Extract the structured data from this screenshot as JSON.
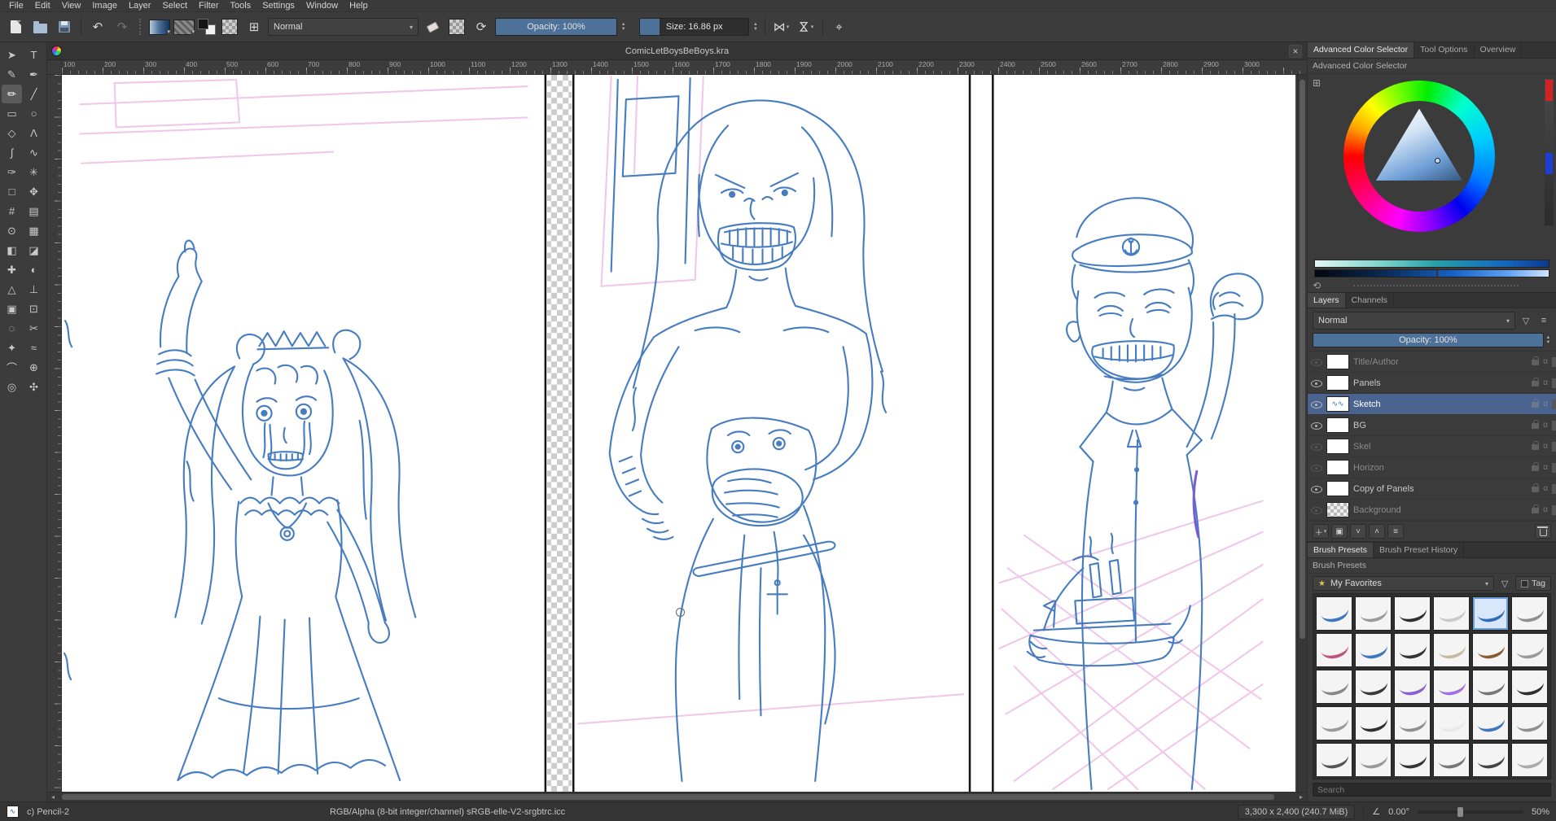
{
  "menubar": {
    "items": [
      "File",
      "Edit",
      "View",
      "Image",
      "Layer",
      "Select",
      "Filter",
      "Tools",
      "Settings",
      "Window",
      "Help"
    ]
  },
  "toolbar": {
    "blend_mode": "Normal",
    "opacity": "Opacity: 100%",
    "size": "Size: 16.86 px"
  },
  "document": {
    "tab_title": "ComicLetBoysBeBoys.kra"
  },
  "icons": {
    "undo": "↶",
    "redo": "↷",
    "reload": "⟳",
    "mirror": "⋈",
    "wrap": "⌖",
    "grid": "⊞",
    "close": "×",
    "caret": "▾",
    "spin_up": "▴",
    "spin_down": "▾",
    "star": "★",
    "filter": "▽",
    "options": "≡",
    "plus": "＋",
    "duplicate": "▣",
    "up": "˄",
    "down": "˅",
    "properties": "≡",
    "arrow_left": "◂",
    "arrow_right": "▸",
    "angle": "∠",
    "refresh": "⟲"
  },
  "toolbox": {
    "tools": [
      {
        "name": "select-shapes-tool",
        "glyph": "➤"
      },
      {
        "name": "text-tool",
        "glyph": "T"
      },
      {
        "name": "edit-shapes-tool",
        "glyph": "✎"
      },
      {
        "name": "calligraphy-tool",
        "glyph": "✒"
      },
      {
        "name": "freehand-brush-tool",
        "glyph": "✏",
        "active": true
      },
      {
        "name": "line-tool",
        "glyph": "╱"
      },
      {
        "name": "rectangle-tool",
        "glyph": "▭"
      },
      {
        "name": "ellipse-tool",
        "glyph": "○"
      },
      {
        "name": "polygon-tool",
        "glyph": "◇"
      },
      {
        "name": "polyline-tool",
        "glyph": "Λ"
      },
      {
        "name": "bezier-curve-tool",
        "glyph": "∫"
      },
      {
        "name": "freehand-path-tool",
        "glyph": "∿"
      },
      {
        "name": "dynamic-brush-tool",
        "glyph": "✑"
      },
      {
        "name": "multibrush-tool",
        "glyph": "✳"
      },
      {
        "name": "transform-tool",
        "glyph": "□"
      },
      {
        "name": "move-tool",
        "glyph": "✥"
      },
      {
        "name": "crop-tool",
        "glyph": "#"
      },
      {
        "name": "gradient-tool",
        "glyph": "▤"
      },
      {
        "name": "color-sampler-tool",
        "glyph": "⊙"
      },
      {
        "name": "pattern-tool",
        "glyph": "▦"
      },
      {
        "name": "fill-tool",
        "glyph": "◧"
      },
      {
        "name": "enclose-fill-tool",
        "glyph": "◪"
      },
      {
        "name": "smart-patch-tool",
        "glyph": "✚"
      },
      {
        "name": "colorize-mask-tool",
        "glyph": "◐"
      },
      {
        "name": "assistants-tool",
        "glyph": "△"
      },
      {
        "name": "measure-tool",
        "glyph": "⊥"
      },
      {
        "name": "reference-images-tool",
        "glyph": "▣"
      },
      {
        "name": "rect-select-tool",
        "glyph": "⊡"
      },
      {
        "name": "ellipse-select-tool",
        "glyph": "◌"
      },
      {
        "name": "freehand-select-tool",
        "glyph": "✂"
      },
      {
        "name": "polygon-select-tool",
        "glyph": "✦"
      },
      {
        "name": "contiguous-select-tool",
        "glyph": "≈"
      },
      {
        "name": "bezier-select-tool",
        "glyph": "⌒"
      },
      {
        "name": "magnetic-select-tool",
        "glyph": "⊕"
      },
      {
        "name": "zoom-tool",
        "glyph": "◎"
      },
      {
        "name": "pan-tool",
        "glyph": "✣"
      }
    ]
  },
  "rulers": {
    "horizontal": [
      "100",
      "200",
      "300",
      "400",
      "500",
      "600",
      "700",
      "800",
      "900",
      "1000",
      "1100",
      "1200",
      "1300",
      "1400",
      "1500",
      "1600",
      "1700",
      "1800",
      "1900",
      "2000",
      "2100",
      "2200",
      "2300",
      "2400",
      "2500",
      "2600",
      "2700",
      "2800",
      "2900",
      "3000"
    ],
    "vertical": [
      "400",
      "500",
      "600",
      "700",
      "800",
      "900",
      "1000",
      "1100",
      "1200",
      "1300",
      "1400",
      "1500",
      "1600",
      "1700",
      "1800",
      "1900",
      "2000"
    ]
  },
  "right_panel": {
    "dock_tabs": [
      {
        "label": "Advanced Color Selector",
        "active": true
      },
      {
        "label": "Tool Options"
      },
      {
        "label": "Overview"
      }
    ],
    "color": {
      "title": "Advanced Color Selector"
    },
    "layers": {
      "tabs": [
        {
          "label": "Layers",
          "active": true
        },
        {
          "label": "Channels"
        }
      ],
      "blend_mode": "Normal",
      "opacity": "Opacity: 100%",
      "items": [
        {
          "name": "Title/Author",
          "visible": false,
          "dim": true,
          "thumb": "white"
        },
        {
          "name": "Panels",
          "visible": true,
          "thumb": "white"
        },
        {
          "name": "Sketch",
          "visible": true,
          "selected": true,
          "thumb": "sketch"
        },
        {
          "name": "BG",
          "visible": true,
          "thumb": "white"
        },
        {
          "name": "Skel",
          "visible": false,
          "dim": true,
          "thumb": "white"
        },
        {
          "name": "Horizon",
          "visible": false,
          "dim": true,
          "thumb": "white"
        },
        {
          "name": "Copy of Panels",
          "visible": true,
          "thumb": "white"
        },
        {
          "name": "Background",
          "visible": false,
          "dim": true,
          "thumb": "checker"
        }
      ]
    },
    "brushes": {
      "tabs": [
        {
          "label": "Brush Presets",
          "active": true
        },
        {
          "label": "Brush Preset History"
        }
      ],
      "title": "Brush Presets",
      "favorites": "My Favorites",
      "tag": "Tag",
      "search_placeholder": "Search",
      "presets": [
        {
          "color": "#3f76c0"
        },
        {
          "color": "#9a9a9a"
        },
        {
          "color": "#2f2f2f"
        },
        {
          "color": "#c9c9c9"
        },
        {
          "color": "#2f6db8",
          "selected": true
        },
        {
          "color": "#8f8f8f"
        },
        {
          "color": "#c2527e"
        },
        {
          "color": "#3f76c0"
        },
        {
          "color": "#333333"
        },
        {
          "color": "#c9b9a0"
        },
        {
          "color": "#8a5a30"
        },
        {
          "color": "#9a9a9a"
        },
        {
          "color": "#888888"
        },
        {
          "color": "#3a3a3a"
        },
        {
          "color": "#8a5fd0"
        },
        {
          "color": "#a070e0"
        },
        {
          "color": "#777777"
        },
        {
          "color": "#2f2f2f"
        },
        {
          "color": "#9a9a9a"
        },
        {
          "color": "#303030"
        },
        {
          "color": "#8f8f8f"
        },
        {
          "color": "#e8e8e8"
        },
        {
          "color": "#3f76c0"
        },
        {
          "color": "#8f8f8f"
        },
        {
          "color": "#555555"
        },
        {
          "color": "#999999"
        },
        {
          "color": "#333333"
        },
        {
          "color": "#777777"
        },
        {
          "color": "#444444"
        },
        {
          "color": "#aaaaaa"
        }
      ]
    }
  },
  "statusbar": {
    "brush": "c) Pencil-2",
    "profile": "RGB/Alpha (8-bit integer/channel)  sRGB-elle-V2-srgbtrc.icc",
    "memory": "3,300 x 2,400 (240.7 MiB)",
    "angle": "0.00°",
    "zoom": "50%"
  }
}
